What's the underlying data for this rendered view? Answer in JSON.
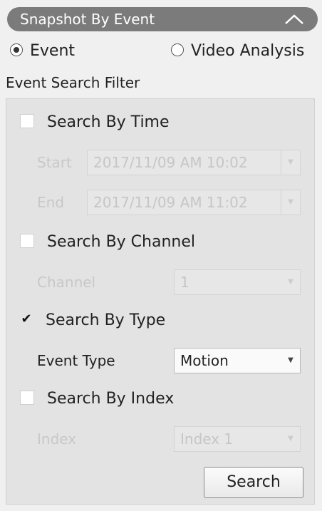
{
  "header": {
    "title": "Snapshot By Event",
    "collapse_icon": "chevron-up-icon"
  },
  "mode": {
    "event_label": "Event",
    "event_selected": true,
    "video_label": "Video Analysis",
    "video_selected": false
  },
  "filter_title": "Event Search Filter",
  "time": {
    "label": "Search By Time",
    "checked": false,
    "start_label": "Start",
    "start_value": "2017/11/09 AM 10:02",
    "end_label": "End",
    "end_value": "2017/11/09 AM 11:02"
  },
  "channel": {
    "label": "Search By Channel",
    "checked": false,
    "field_label": "Channel",
    "value": "1"
  },
  "type": {
    "label": "Search By Type",
    "checked": true,
    "check_glyph": "✔",
    "field_label": "Event Type",
    "value": "Motion"
  },
  "index": {
    "label": "Search By Index",
    "checked": false,
    "field_label": "Index",
    "value": "Index 1"
  },
  "search_label": "Search",
  "colors": {
    "header_bg": "#7b7b7b",
    "panel_bg": "#e3e3e3",
    "disabled_text": "#c8c8c8"
  }
}
